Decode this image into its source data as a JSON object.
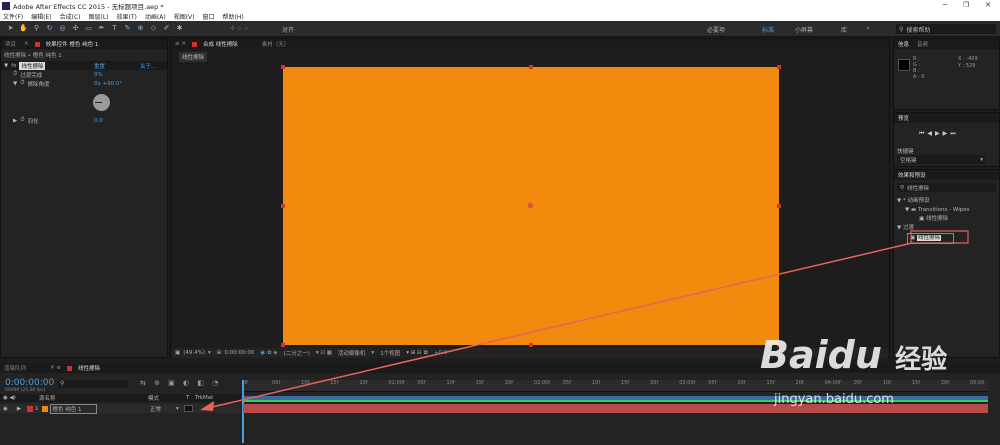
{
  "window": {
    "title": "Adobe After Effects CC 2015 - 无标题项目.aep *",
    "min": "─",
    "max": "❐",
    "close": "✕"
  },
  "menu": [
    "文件(F)",
    "编辑(E)",
    "合成(C)",
    "图层(L)",
    "效果(T)",
    "动画(A)",
    "视图(V)",
    "窗口",
    "帮助(H)"
  ],
  "toolbar": {
    "snap_label": "对齐",
    "workspaces": [
      "必要项",
      "标准",
      "小屏幕",
      "库"
    ],
    "workspace_active": "标准",
    "search_help": "搜索帮助"
  },
  "left_panel": {
    "tabs": [
      "项目",
      "效果控件 橙色 纯色 1"
    ],
    "breadcrumb": "线性擦除 • 橙色 纯色 1",
    "header_reset": "重置",
    "header_about": "关于...",
    "effect_name": "线性擦除",
    "props": [
      {
        "name": "过渡完成",
        "value": "0%"
      },
      {
        "name": "擦除角度",
        "value": "0x +90.0°"
      },
      {
        "name": "羽化",
        "value": "0.0"
      }
    ]
  },
  "comp_panel": {
    "tabs": [
      "合成 线性擦除",
      "素材（无）"
    ],
    "sub_tab": "线性擦除",
    "footer": {
      "zoom": "(49.4%)",
      "timecode": "0:00:00:00",
      "resolution": "(二分之一)",
      "camera": "活动摄像机",
      "views": "1个视图",
      "exposure": "+0.0"
    }
  },
  "right_panel": {
    "info_tabs": [
      "信息",
      "音频"
    ],
    "info_rgb": [
      "R :",
      "G :",
      "B :",
      "A : 0"
    ],
    "info_xy": [
      "X : -409",
      "Y : 529"
    ],
    "preview_tab": "预览",
    "shortcut_label": "快捷键",
    "shortcut_value": "空格键",
    "effects_tab": "效果和预设",
    "effects_search": "线性擦除",
    "tree": [
      {
        "label": "* 动画预设",
        "depth": 0
      },
      {
        "label": "Transitions - Wipes",
        "depth": 1
      },
      {
        "label": "线性擦除",
        "depth": 2
      },
      {
        "label": "过渡",
        "depth": 0
      },
      {
        "label": "线性擦除",
        "depth": 1,
        "selected": true
      }
    ]
  },
  "timeline": {
    "tabs": [
      "渲染队列",
      "线性擦除"
    ],
    "timecode": "0:00:00:00",
    "timecode_sub": "00000 (25.00 fps)",
    "cols": [
      "源名称",
      "模式",
      "T",
      "TrkMat"
    ],
    "layer": {
      "num": "1",
      "name": "橙色 纯色 1",
      "mode": "正常"
    },
    "ruler": [
      "0f",
      "05f",
      "10f",
      "15f",
      "20f",
      "01:00f",
      "05f",
      "10f",
      "15f",
      "20f",
      "02:00f",
      "05f",
      "10f",
      "15f",
      "20f",
      "03:00f",
      "05f",
      "10f",
      "15f",
      "20f",
      "04:00f",
      "05f",
      "10f",
      "15f",
      "20f",
      "05:00"
    ]
  },
  "watermark": {
    "brand": "Baidu",
    "sub": "经验",
    "url": "jingyan.baidu.com"
  },
  "colors": {
    "accent": "#4a9fe0",
    "solid": "#f28a0e",
    "layer_bar": "#b84a4a",
    "arrow": "#e8645a"
  }
}
